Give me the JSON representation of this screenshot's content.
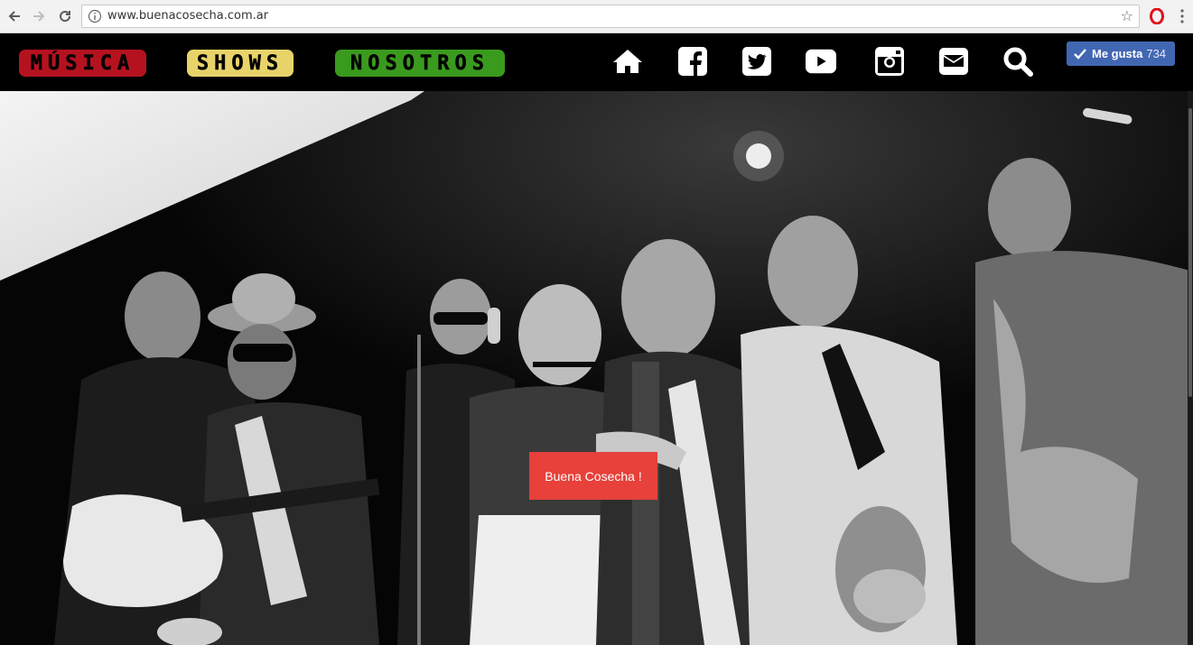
{
  "browser": {
    "url": "www.buenacosecha.com.ar",
    "back_icon": "arrow-left-icon",
    "forward_icon": "arrow-right-icon",
    "reload_icon": "reload-icon",
    "star_icon": "star-icon",
    "extension_icon": "opera-icon",
    "menu_icon": "kebab-menu-icon"
  },
  "header": {
    "menu": [
      {
        "label": "MÚSICA",
        "color": "#b5121f"
      },
      {
        "label": "SHOWS",
        "color": "#e8d36a"
      },
      {
        "label": "NOSOTROS",
        "color": "#3a9a1e"
      }
    ],
    "social_icons": [
      "home-icon",
      "facebook-icon",
      "twitter-icon",
      "youtube-icon",
      "instagram-icon",
      "mail-icon",
      "search-icon"
    ],
    "fb_like": {
      "label": "Me gusta",
      "count": "734",
      "color": "#4267b2"
    }
  },
  "hero": {
    "button_label": "Buena Cosecha !",
    "button_color": "#e8403a"
  }
}
